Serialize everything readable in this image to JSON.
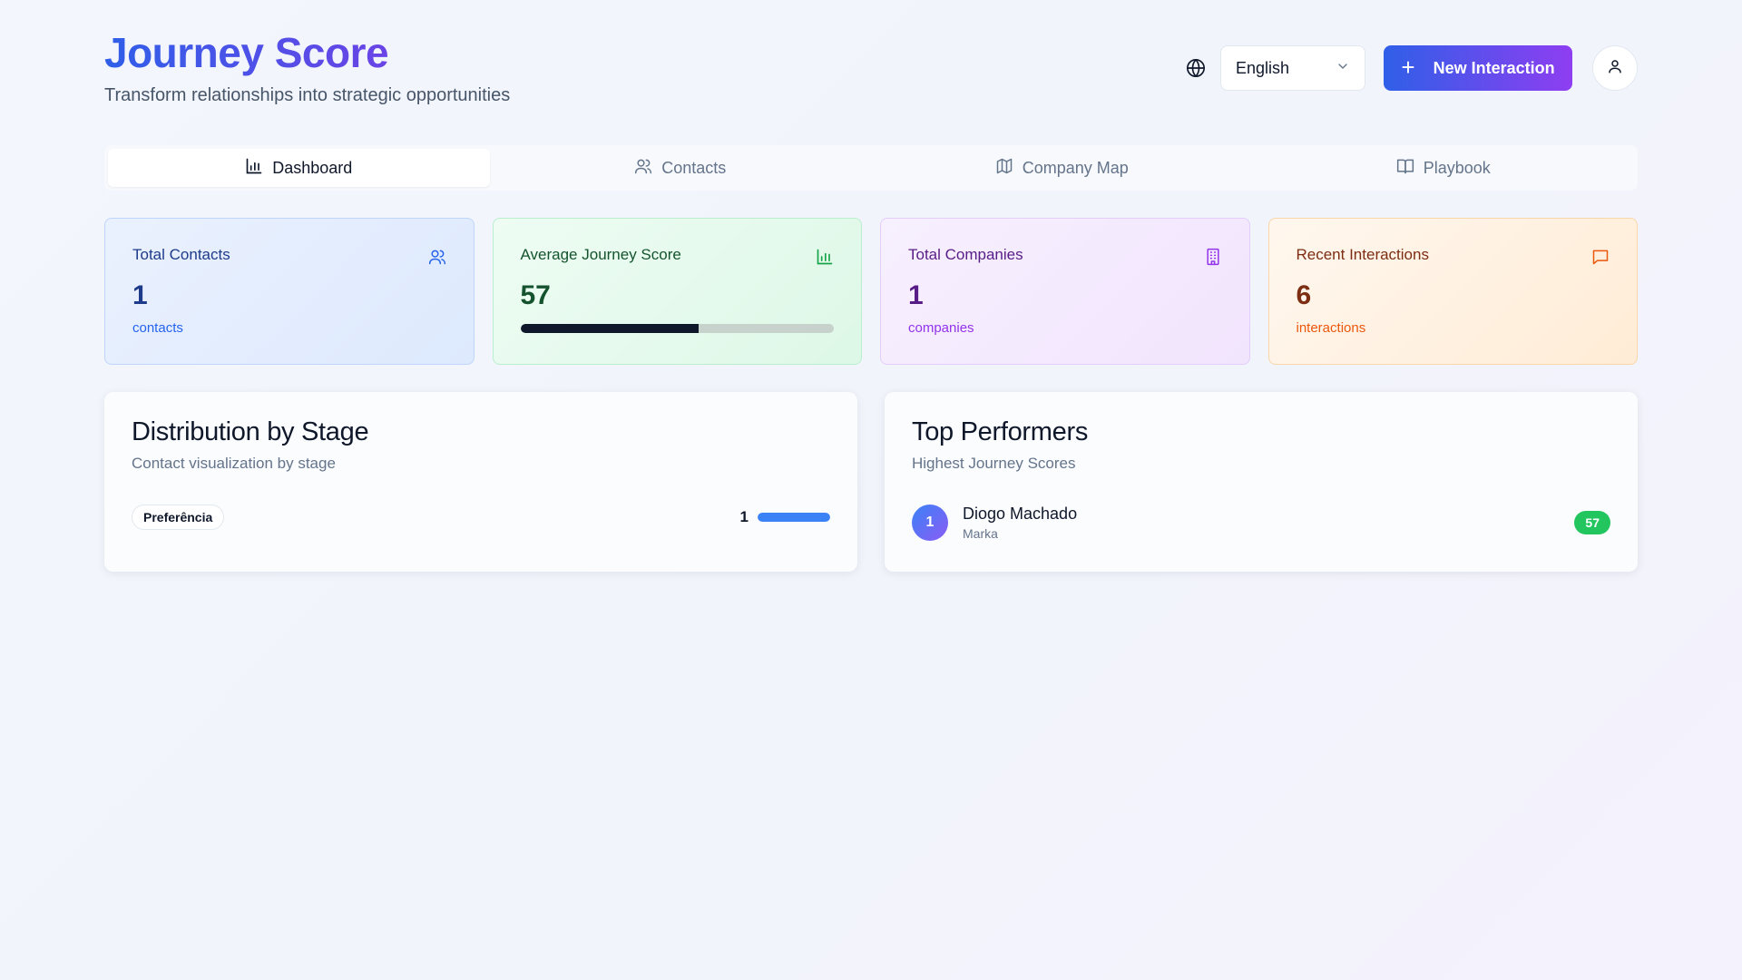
{
  "header": {
    "title": "Journey Score",
    "subtitle": "Transform relationships into strategic opportunities",
    "language": "English",
    "new_button": "New Interaction",
    "icons": {
      "language": "globe-icon",
      "language_dropdown": "chevron-down-icon",
      "new": "plus-icon",
      "user": "user-icon"
    }
  },
  "tabs": [
    {
      "label": "Dashboard",
      "icon": "bar-chart-icon",
      "active": true
    },
    {
      "label": "Contacts",
      "icon": "users-icon",
      "active": false
    },
    {
      "label": "Company Map",
      "icon": "map-icon",
      "active": false
    },
    {
      "label": "Playbook",
      "icon": "book-icon",
      "active": false
    }
  ],
  "stats": {
    "total_contacts": {
      "label": "Total Contacts",
      "value": "1",
      "sub": "contacts",
      "icon": "users-icon"
    },
    "avg_score": {
      "label": "Average Journey Score",
      "value": "57",
      "progress": 57,
      "icon": "bar-chart-icon"
    },
    "total_companies": {
      "label": "Total Companies",
      "value": "1",
      "sub": "companies",
      "icon": "building-icon"
    },
    "recent_interactions": {
      "label": "Recent Interactions",
      "value": "6",
      "sub": "interactions",
      "icon": "message-icon"
    }
  },
  "distribution": {
    "title": "Distribution by Stage",
    "subtitle": "Contact visualization by stage",
    "stages": [
      {
        "name": "Preferência",
        "count": "1",
        "fraction": 1.0
      }
    ]
  },
  "performers": {
    "title": "Top Performers",
    "subtitle": "Highest Journey Scores",
    "items": [
      {
        "rank": "1",
        "name": "Diogo Machado",
        "company": "Marka",
        "score": "57"
      }
    ]
  },
  "colors": {
    "accent_start": "#2f5fe8",
    "accent_end": "#8e3ef0",
    "blue": "#1e3a8a",
    "green": "#14532d",
    "purple": "#581c87",
    "orange": "#7c2d12",
    "score_badge": "#22c55e",
    "stage_bar": "#3b82f6"
  }
}
